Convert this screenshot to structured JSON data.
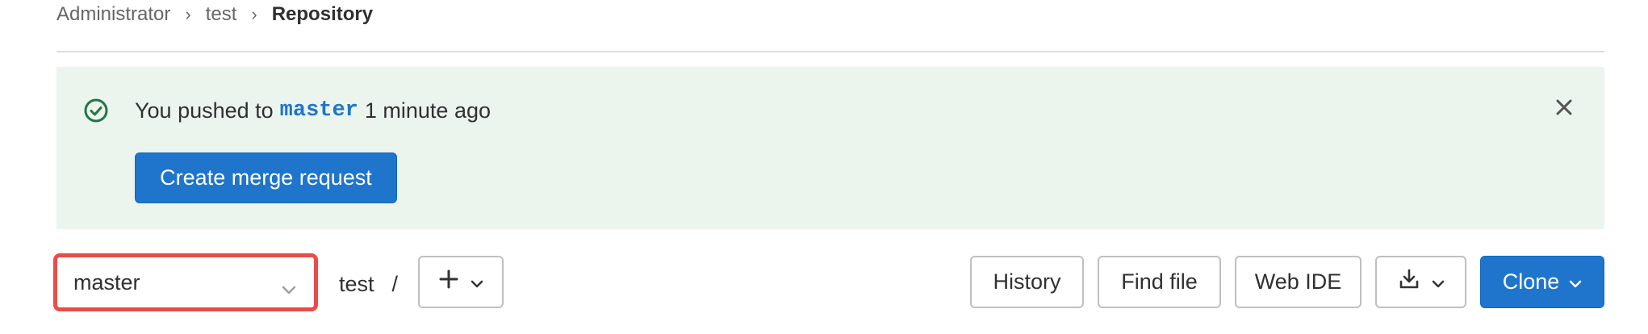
{
  "breadcrumb": {
    "items": [
      "Administrator",
      "test"
    ],
    "current": "Repository",
    "separator": "›"
  },
  "alert": {
    "prefix": "You pushed to",
    "branch": "master",
    "suffix": "1 minute ago",
    "action_label": "Create merge request",
    "icon": "check-circle-icon",
    "close_icon": "close-icon"
  },
  "branch_selector": {
    "value": "master",
    "icon": "chevron-down-icon"
  },
  "path": {
    "project": "test",
    "separator": "/"
  },
  "toolbar": {
    "add_icon": "plus-icon",
    "history_label": "History",
    "find_file_label": "Find file",
    "web_ide_label": "Web IDE",
    "download_icon": "download-icon",
    "clone_label": "Clone"
  },
  "colors": {
    "primary": "#1f75cb",
    "alert_bg": "#ecf4ee",
    "success": "#217645",
    "highlight_border": "#ec4c47"
  }
}
